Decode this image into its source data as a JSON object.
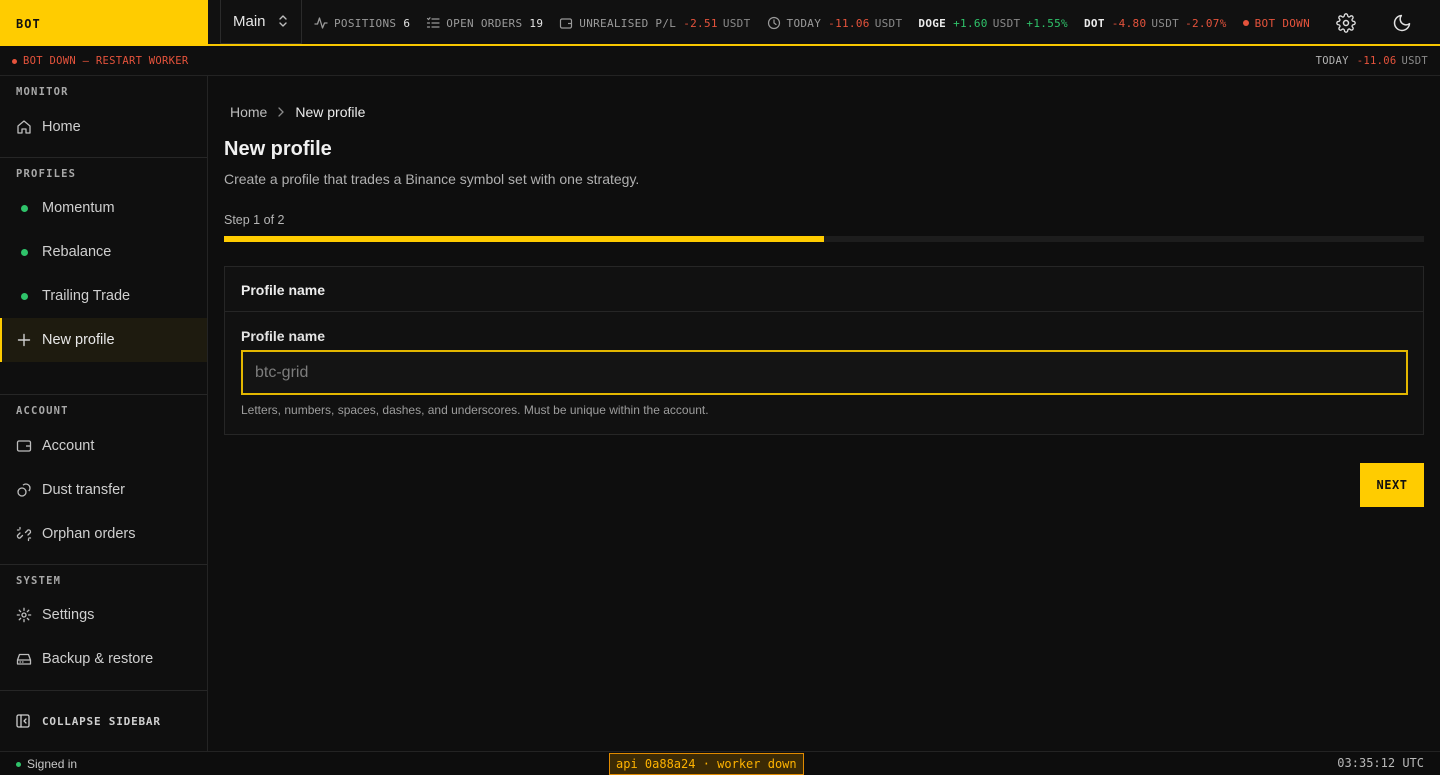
{
  "brand": {
    "label": "BOT",
    "color": "#ffcc00"
  },
  "header": {
    "account_select": "Main",
    "stats": {
      "positions": {
        "label": "POSITIONS",
        "value": "6"
      },
      "open_orders": {
        "label": "OPEN ORDERS",
        "value": "19"
      },
      "unrealised": {
        "label": "UNREALISED P/L",
        "value": "-2.51",
        "unit": "USDT"
      },
      "today": {
        "label": "TODAY",
        "value": "-11.06",
        "unit": "USDT"
      },
      "doge": {
        "symbol": "DOGE",
        "value": "+1.60",
        "unit": "USDT",
        "pct": "+1.55%"
      },
      "dot": {
        "symbol": "DOT",
        "value": "-4.80",
        "unit": "USDT",
        "pct": "-2.07%"
      },
      "status": "BOT DOWN"
    },
    "icons": {
      "settings": "gear-icon",
      "theme": "moon-icon"
    }
  },
  "alert": {
    "message": "BOT DOWN — RESTART WORKER",
    "today_label": "TODAY",
    "today_value": "-11.06",
    "today_unit": "USDT"
  },
  "sidebar": {
    "monitor": {
      "title": "MONITOR",
      "items": [
        {
          "label": "Home",
          "icon": "home-icon"
        }
      ]
    },
    "profiles": {
      "title": "PROFILES",
      "items": [
        {
          "label": "Momentum",
          "status": "active"
        },
        {
          "label": "Rebalance",
          "status": "active"
        },
        {
          "label": "Trailing Trade",
          "status": "active"
        }
      ],
      "new_label": "New profile"
    },
    "account": {
      "title": "ACCOUNT",
      "items": [
        {
          "label": "Account",
          "icon": "wallet-icon"
        },
        {
          "label": "Dust transfer",
          "icon": "coins-icon"
        },
        {
          "label": "Orphan orders",
          "icon": "broken-link-icon"
        }
      ]
    },
    "system": {
      "title": "SYSTEM",
      "items": [
        {
          "label": "Settings",
          "icon": "gear-icon"
        },
        {
          "label": "Backup & restore",
          "icon": "hard-drive-icon"
        }
      ]
    },
    "collapse_label": "COLLAPSE SIDEBAR"
  },
  "main": {
    "breadcrumb": {
      "home": "Home",
      "current": "New profile"
    },
    "title": "New profile",
    "subtitle": "Create a profile that trades a Binance symbol set with one strategy.",
    "step_label": "Step 1 of 2",
    "progress": 0.5,
    "card": {
      "header": "Profile name",
      "field_label": "Profile name",
      "placeholder": "btc-grid",
      "value": "",
      "help": "Letters, numbers, spaces, dashes, and underscores. Must be unique within the account."
    },
    "next_label": "NEXT"
  },
  "footer": {
    "signed_in": "Signed in",
    "api_status": "api 0a88a24 · worker down",
    "clock": "03:35:12 UTC"
  }
}
